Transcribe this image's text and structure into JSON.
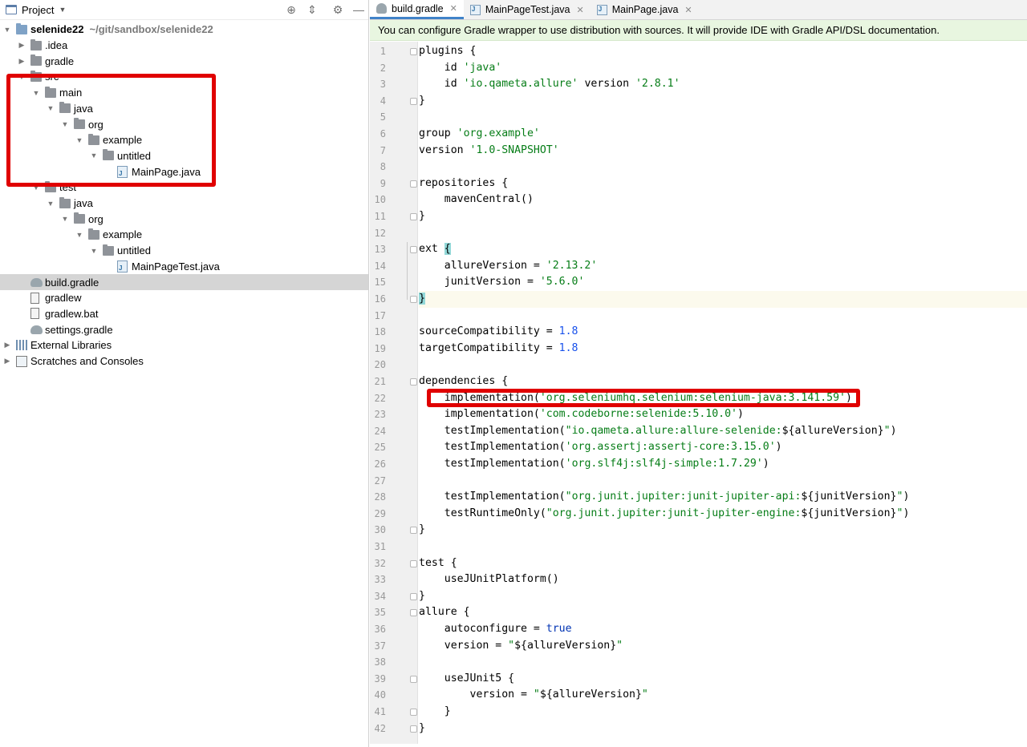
{
  "project_panel": {
    "title": "Project",
    "tree": [
      {
        "label": "selenide22",
        "path": "~/git/sandbox/selenide22",
        "icon": "module-folder-icon",
        "expanded": true
      },
      {
        "label": ".idea",
        "icon": "folder-icon",
        "expanded": false
      },
      {
        "label": "gradle",
        "icon": "folder-icon",
        "expanded": false
      },
      {
        "label": "src",
        "icon": "folder-icon",
        "expanded": true
      },
      {
        "label": "main",
        "icon": "folder-icon",
        "expanded": true
      },
      {
        "label": "java",
        "icon": "folder-icon",
        "expanded": true
      },
      {
        "label": "org",
        "icon": "folder-icon",
        "expanded": true
      },
      {
        "label": "example",
        "icon": "folder-icon",
        "expanded": true
      },
      {
        "label": "untitled",
        "icon": "folder-icon",
        "expanded": true
      },
      {
        "label": "MainPage.java",
        "icon": "java-file-icon"
      },
      {
        "label": "test",
        "icon": "folder-icon",
        "expanded": true
      },
      {
        "label": "java",
        "icon": "folder-icon",
        "expanded": true
      },
      {
        "label": "org",
        "icon": "folder-icon",
        "expanded": true
      },
      {
        "label": "example",
        "icon": "folder-icon",
        "expanded": true
      },
      {
        "label": "untitled",
        "icon": "folder-icon",
        "expanded": true
      },
      {
        "label": "MainPageTest.java",
        "icon": "java-file-icon"
      },
      {
        "label": "build.gradle",
        "icon": "gradle-file-icon",
        "selected": true
      },
      {
        "label": "gradlew",
        "icon": "script-file-icon"
      },
      {
        "label": "gradlew.bat",
        "icon": "text-file-icon"
      },
      {
        "label": "settings.gradle",
        "icon": "gradle-file-icon"
      },
      {
        "label": "External Libraries",
        "icon": "library-icon",
        "expanded": false
      },
      {
        "label": "Scratches and Consoles",
        "icon": "scratch-icon",
        "expanded": false
      }
    ]
  },
  "editor": {
    "tabs": [
      {
        "label": "build.gradle",
        "active": true
      },
      {
        "label": "MainPageTest.java",
        "active": false
      },
      {
        "label": "MainPage.java",
        "active": false
      }
    ],
    "banner": "You can configure Gradle wrapper to use distribution with sources. It will provide IDE with Gradle API/DSL documentation.",
    "lines": [
      "plugins {",
      "    id 'java'",
      "    id 'io.qameta.allure' version '2.8.1'",
      "}",
      "",
      "group 'org.example'",
      "version '1.0-SNAPSHOT'",
      "",
      "repositories {",
      "    mavenCentral()",
      "}",
      "",
      "ext {",
      "    allureVersion = '2.13.2'",
      "    junitVersion = '5.6.0'",
      "}",
      "",
      "sourceCompatibility = 1.8",
      "targetCompatibility = 1.8",
      "",
      "dependencies {",
      "    implementation('org.seleniumhq.selenium:selenium-java:3.141.59')",
      "    implementation('com.codeborne:selenide:5.10.0')",
      "    testImplementation(\"io.qameta.allure:allure-selenide:${allureVersion}\")",
      "    testImplementation('org.assertj:assertj-core:3.15.0')",
      "    testImplementation('org.slf4j:slf4j-simple:1.7.29')",
      "",
      "    testImplementation(\"org.junit.jupiter:junit-jupiter-api:${junitVersion}\")",
      "    testRuntimeOnly(\"org.junit.jupiter:junit-jupiter-engine:${junitVersion}\")",
      "}",
      "",
      "test {",
      "    useJUnitPlatform()",
      "}",
      "allure {",
      "    autoconfigure = true",
      "    version = \"${allureVersion}\"",
      "",
      "    useJUnit5 {",
      "        version = \"${allureVersion}\"",
      "    }",
      "}"
    ],
    "current_line": 16
  },
  "colors": {
    "string": "#067d17",
    "number": "#1750eb",
    "keyword": "#0033b3",
    "highlight_box": "#e00000",
    "banner_bg": "#e8f6e0"
  }
}
